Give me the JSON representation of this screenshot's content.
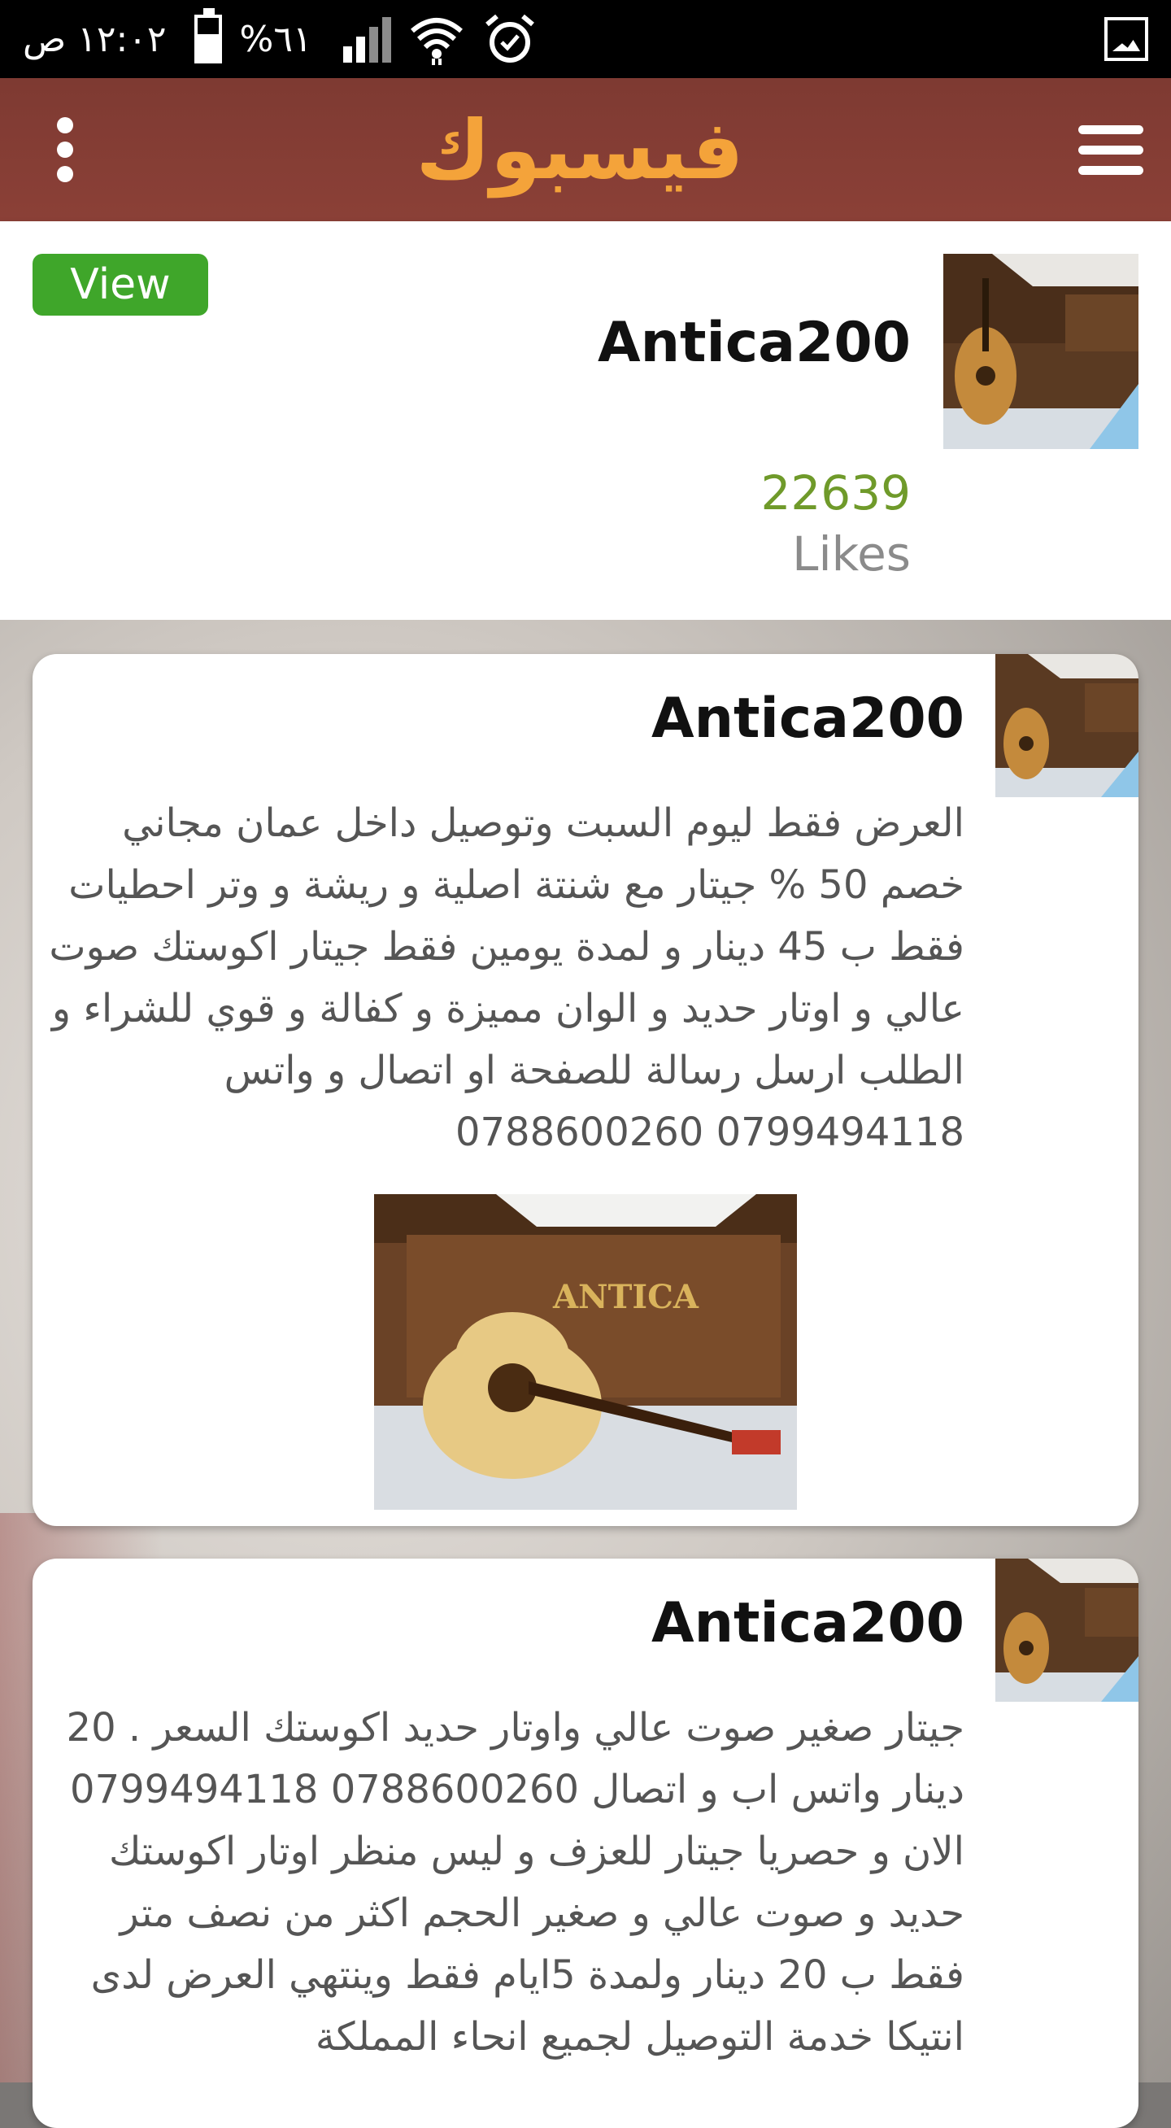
{
  "status_bar": {
    "time": "١٢:٠٢ ص",
    "battery": "%٦١",
    "battery_level": 0.61
  },
  "app_bar": {
    "title": "فيسبوك"
  },
  "page_header": {
    "view_label": "View",
    "page_name": "Antica200",
    "likes_count": "22639",
    "likes_label": "Likes"
  },
  "posts": [
    {
      "author": "Antica200",
      "text": "العرض فقط ليوم السبت وتوصيل داخل عمان مجاني خصم 50 % جيتار مع شنتة اصلية و ريشة و وتر احطيات فقط ب 45 دينار و لمدة يومين فقط جيتار اكوستك صوت عالي و اوتار حديد و الوان مميزة و كفالة و قوي للشراء و الطلب ارسل رسالة للصفحة او اتصال و واتس 0799494118 0788600260"
    },
    {
      "author": "Antica200",
      "text": "جيتار صغير صوت عالي واوتار حديد اكوستك السعر . 20 دينار واتس اب و اتصال 0788600260 0799494118 الان و حصريا جيتار للعزف و ليس منظر اوتار اكوستك حديد و صوت عالي و صغير الحجم اكثر من نصف متر فقط ب 20 دينار ولمدة 5ايام فقط وينتهي العرض لدى انتيكا خدمة التوصيل لجميع انحاء المملكة"
    }
  ],
  "colors": {
    "app_bar": "#8b4037",
    "title": "#f4a33a",
    "view_button": "#3fa62a",
    "likes_count": "#6f9a2a"
  }
}
